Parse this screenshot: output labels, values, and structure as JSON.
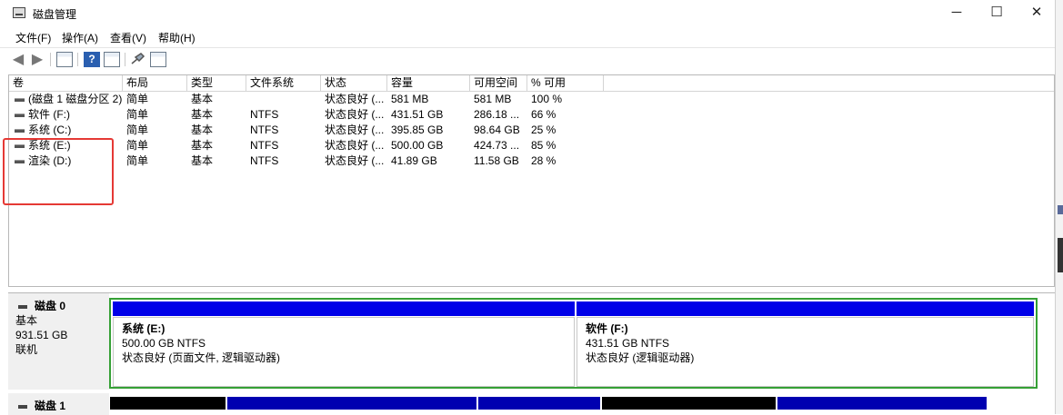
{
  "window": {
    "title": "磁盘管理"
  },
  "window_controls": {
    "minimize": "─",
    "maximize": "☐",
    "close": "✕"
  },
  "menu": [
    "文件(F)",
    "操作(A)",
    "查看(V)",
    "帮助(H)"
  ],
  "toolbar": {
    "icons": [
      "back-arrow-icon",
      "forward-arrow-icon",
      "volume-list-icon",
      "help-icon",
      "disk-view-icon",
      "connect-icon",
      "properties-icon"
    ],
    "help_glyph": "?"
  },
  "volume_table": {
    "columns": [
      "卷",
      "布局",
      "类型",
      "文件系统",
      "状态",
      "容量",
      "可用空间",
      "% 可用"
    ],
    "rows": [
      [
        "(磁盘 1 磁盘分区 2)",
        "简单",
        "基本",
        "",
        "状态良好 (...",
        "581 MB",
        "581 MB",
        "100 %"
      ],
      [
        "软件 (F:)",
        "简单",
        "基本",
        "NTFS",
        "状态良好 (...",
        "431.51 GB",
        "286.18 ...",
        "66 %"
      ],
      [
        "系统 (C:)",
        "简单",
        "基本",
        "NTFS",
        "状态良好 (...",
        "395.85 GB",
        "98.64 GB",
        "25 %"
      ],
      [
        "系统 (E:)",
        "简单",
        "基本",
        "NTFS",
        "状态良好 (...",
        "500.00 GB",
        "424.73 ...",
        "85 %"
      ],
      [
        "渲染 (D:)",
        "简单",
        "基本",
        "NTFS",
        "状态良好 (...",
        "41.89 GB",
        "11.58 GB",
        "28 %"
      ]
    ]
  },
  "disks": {
    "disk0": {
      "name": "磁盘 0",
      "type": "基本",
      "size": "931.51 GB",
      "status": "联机",
      "partitions": [
        {
          "name": "系统 (E:)",
          "size_fs": "500.00 GB NTFS",
          "status": "状态良好 (页面文件, 逻辑驱动器)"
        },
        {
          "name": "软件 (F:)",
          "size_fs": "431.51 GB NTFS",
          "status": "状态良好 (逻辑驱动器)"
        }
      ]
    },
    "disk1": {
      "name": "磁盘 1"
    }
  },
  "colors": {
    "primary_partition_bar": "#0000e8",
    "unallocated_bar": "#000000",
    "extended_partition_border": "#35a035",
    "highlight_box": "#e53935"
  }
}
